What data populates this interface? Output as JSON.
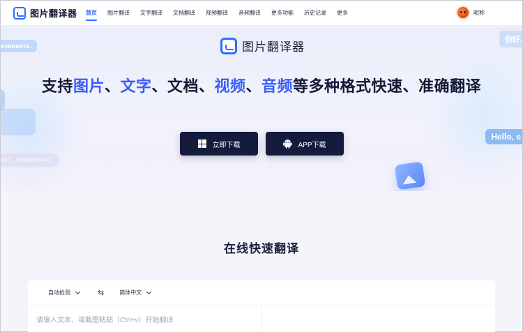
{
  "nav": {
    "brand": "图片翻译器",
    "items": [
      {
        "label": "首页",
        "active": true
      },
      {
        "label": "图片翻译",
        "active": false
      },
      {
        "label": "文字翻译",
        "active": false
      },
      {
        "label": "文档翻译",
        "active": false
      },
      {
        "label": "视频翻译",
        "active": false
      },
      {
        "label": "音频翻译",
        "active": false
      },
      {
        "label": "更多功能",
        "active": false
      },
      {
        "label": "历史记录",
        "active": false
      },
      {
        "label": "更多",
        "active": false
      }
    ],
    "user_nickname": "昵称"
  },
  "hero": {
    "brand": "图片翻译器",
    "headline": {
      "prefix": "支持",
      "hl1": "图片",
      "sep1": "、",
      "hl2": "文字",
      "sep2": "、文档、",
      "hl3": "视频",
      "sep3": "、",
      "hl4": "音频",
      "suffix": "等多种格式快速、准确翻译"
    },
    "download_button": "立即下载",
    "app_button": "APP下载",
    "bubbles": {
      "top_left": "извините.",
      "mid_left": "вет, извините.",
      "top_right": "你好,",
      "mid_right": "Hello, e"
    }
  },
  "translate": {
    "title": "在线快速翻译",
    "source_lang": "自动检测",
    "swap_icon": "⇆",
    "target_lang": "简体中文",
    "input_placeholder": "请输入文本、或截图粘贴（Ctrl+v）开始翻译"
  },
  "colors": {
    "accent": "#2f6bff",
    "headline_highlight": "#3a5cf5",
    "button_bg": "#151b3d"
  }
}
